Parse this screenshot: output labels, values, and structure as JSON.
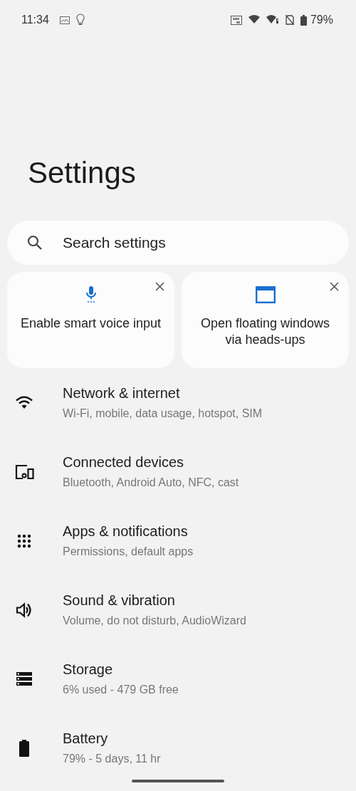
{
  "status_bar": {
    "time": "11:34",
    "battery": "79%"
  },
  "title": "Settings",
  "search": {
    "placeholder": "Search settings"
  },
  "suggestions": [
    {
      "label": "Enable smart voice input"
    },
    {
      "label": "Open floating windows via heads-ups"
    }
  ],
  "items": [
    {
      "title": "Network & internet",
      "subtitle": "Wi‑Fi, mobile, data usage, hotspot, SIM"
    },
    {
      "title": "Connected devices",
      "subtitle": "Bluetooth, Android Auto, NFC, cast"
    },
    {
      "title": "Apps & notifications",
      "subtitle": "Permissions, default apps"
    },
    {
      "title": "Sound & vibration",
      "subtitle": "Volume, do not disturb, AudioWizard"
    },
    {
      "title": "Storage",
      "subtitle": "6% used - 479 GB free"
    },
    {
      "title": "Battery",
      "subtitle": "79% - 5 days, 11 hr"
    }
  ]
}
